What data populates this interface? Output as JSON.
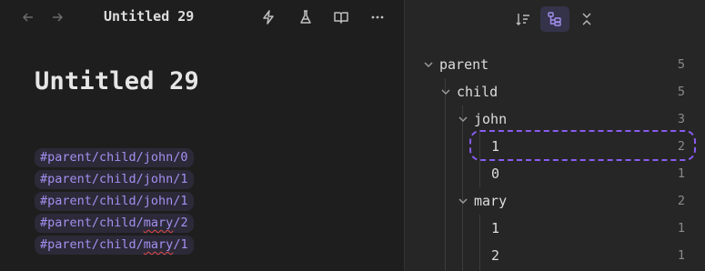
{
  "editor": {
    "tab_title": "Untitled 29",
    "doc_title": "Untitled 29",
    "tags": [
      {
        "text": "#parent/child/john/0",
        "misspelled": null
      },
      {
        "text": "#parent/child/john/1",
        "misspelled": null
      },
      {
        "text": "#parent/child/john/1",
        "misspelled": null
      },
      {
        "prefix": "#parent/child/",
        "word": "mary",
        "suffix": "/2",
        "misspelled": "mary"
      },
      {
        "prefix": "#parent/child/",
        "word": "mary",
        "suffix": "/1",
        "misspelled": "mary"
      }
    ],
    "toolbar": {
      "back": "back-arrow-icon",
      "forward": "forward-arrow-icon",
      "actions": [
        "lightning-icon",
        "flask-icon",
        "book-open-icon",
        "more-horizontal-icon"
      ]
    }
  },
  "tag_pane": {
    "header_buttons": [
      "sort-icon",
      "tree-view-icon",
      "collapse-all-icon"
    ],
    "active_button": "tree-view-icon",
    "tree": [
      {
        "label": "parent",
        "count": "5"
      },
      {
        "label": "child",
        "count": "5"
      },
      {
        "label": "john",
        "count": "3"
      },
      {
        "label": "1",
        "count": "2"
      },
      {
        "label": "0",
        "count": "1"
      },
      {
        "label": "mary",
        "count": "2"
      },
      {
        "label": "1",
        "count": "1"
      },
      {
        "label": "2",
        "count": "1"
      }
    ],
    "highlight_color": "#8a5cf0"
  },
  "colors": {
    "background": "#1e1e1e",
    "panel": "#262626",
    "tag_text": "#a48ff0",
    "tag_bg": "#2c2a38",
    "accent": "#a48ff0"
  }
}
